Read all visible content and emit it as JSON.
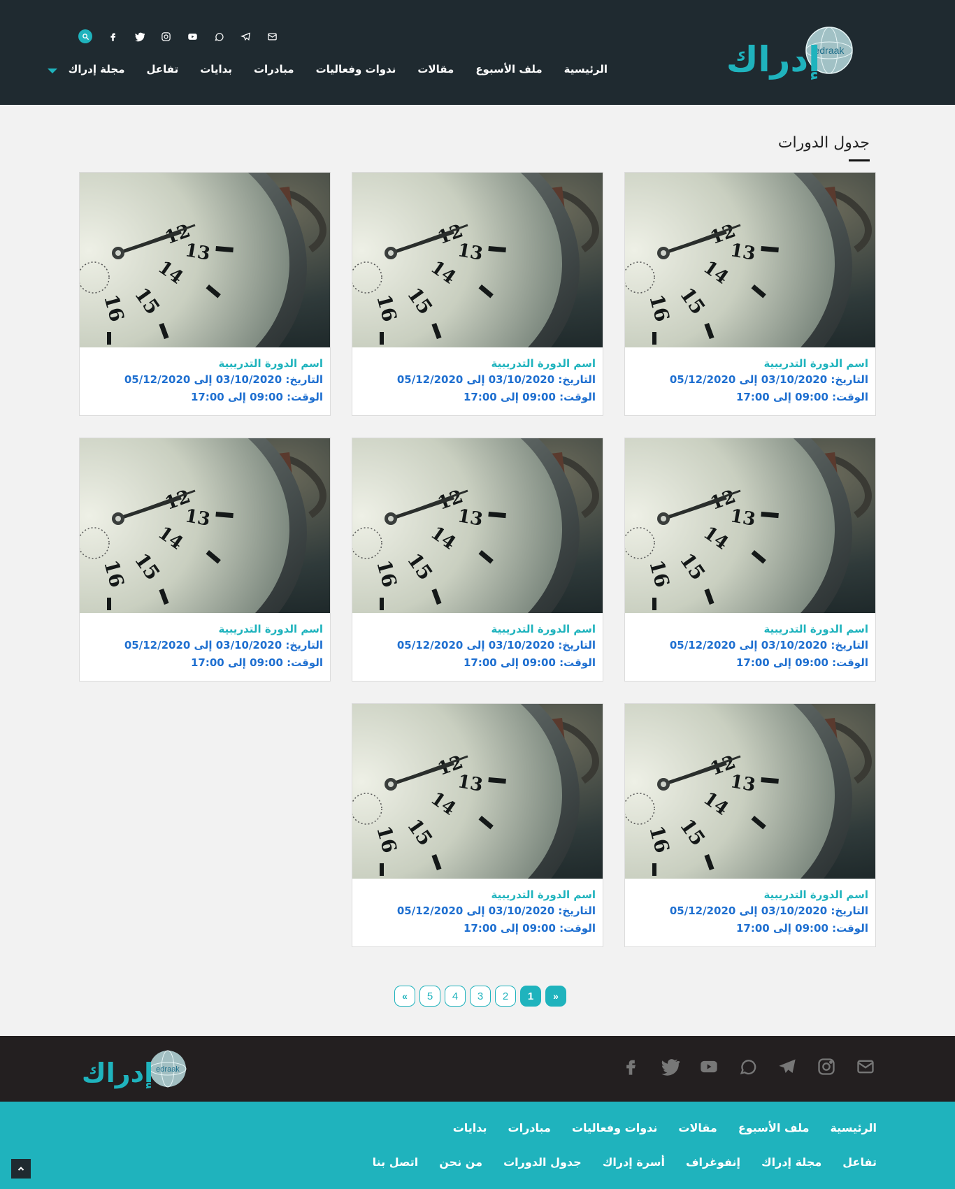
{
  "header": {
    "logo_text": "إدراك",
    "logo_sub": "edraak",
    "social_icons": [
      "envelope-icon",
      "telegram-icon",
      "whatsapp-icon",
      "youtube-icon",
      "instagram-icon",
      "twitter-icon",
      "facebook-icon",
      "search-icon"
    ],
    "nav": [
      "الرئيسية",
      "ملف الأسبوع",
      "مقالات",
      "ندوات وفعاليات",
      "مبادرات",
      "بدايات",
      "تفاعل"
    ],
    "nav_dropdown": "مجلة إدراك"
  },
  "page": {
    "title": "جدول الدورات"
  },
  "courses": [
    {
      "title": "اسم الدورة التدريبية",
      "date": "التاريخ: 03/10/2020 إلى 05/12/2020",
      "time": "الوقت: 09:00 إلى 17:00"
    },
    {
      "title": "اسم الدورة التدريبية",
      "date": "التاريخ: 03/10/2020 إلى 05/12/2020",
      "time": "الوقت: 09:00 إلى 17:00"
    },
    {
      "title": "اسم الدورة التدريبية",
      "date": "التاريخ: 03/10/2020 إلى 05/12/2020",
      "time": "الوقت: 09:00 إلى 17:00"
    },
    {
      "title": "اسم الدورة التدريبية",
      "date": "التاريخ: 03/10/2020 إلى 05/12/2020",
      "time": "الوقت: 09:00 إلى 17:00"
    },
    {
      "title": "اسم الدورة التدريبية",
      "date": "التاريخ: 03/10/2020 إلى 05/12/2020",
      "time": "الوقت: 09:00 إلى 17:00"
    },
    {
      "title": "اسم الدورة التدريبية",
      "date": "التاريخ: 03/10/2020 إلى 05/12/2020",
      "time": "الوقت: 09:00 إلى 17:00"
    },
    {
      "title": "اسم الدورة التدريبية",
      "date": "التاريخ: 03/10/2020 إلى 05/12/2020",
      "time": "الوقت: 09:00 إلى 17:00"
    },
    {
      "title": "اسم الدورة التدريبية",
      "date": "التاريخ: 03/10/2020 إلى 05/12/2020",
      "time": "الوقت: 09:00 إلى 17:00"
    }
  ],
  "pagination": {
    "prev": "«",
    "pages": [
      "5",
      "4",
      "3",
      "2",
      "1"
    ],
    "active": "1",
    "next": "»"
  },
  "footer": {
    "logo_text": "إدراك",
    "logo_sub": "edraak",
    "social_icons": [
      "envelope-icon",
      "instagram-icon",
      "telegram-icon",
      "whatsapp-icon",
      "youtube-icon",
      "twitter-icon",
      "facebook-icon"
    ],
    "links_row1": [
      "الرئيسية",
      "ملف الأسبوع",
      "مقالات",
      "ندوات وفعاليات",
      "مبادرات",
      "بدايات"
    ],
    "links_row2": [
      "تفاعل",
      "مجلة إدراك",
      "إنفوغراف",
      "أسرة إدراك",
      "جدول الدورات",
      "من نحن",
      "اتصل بنا"
    ]
  },
  "colors": {
    "header_bg": "#1f2a30",
    "accent": "#1fb3bd",
    "link_blue": "#1e6fd0",
    "footer_dark": "#231f20"
  }
}
